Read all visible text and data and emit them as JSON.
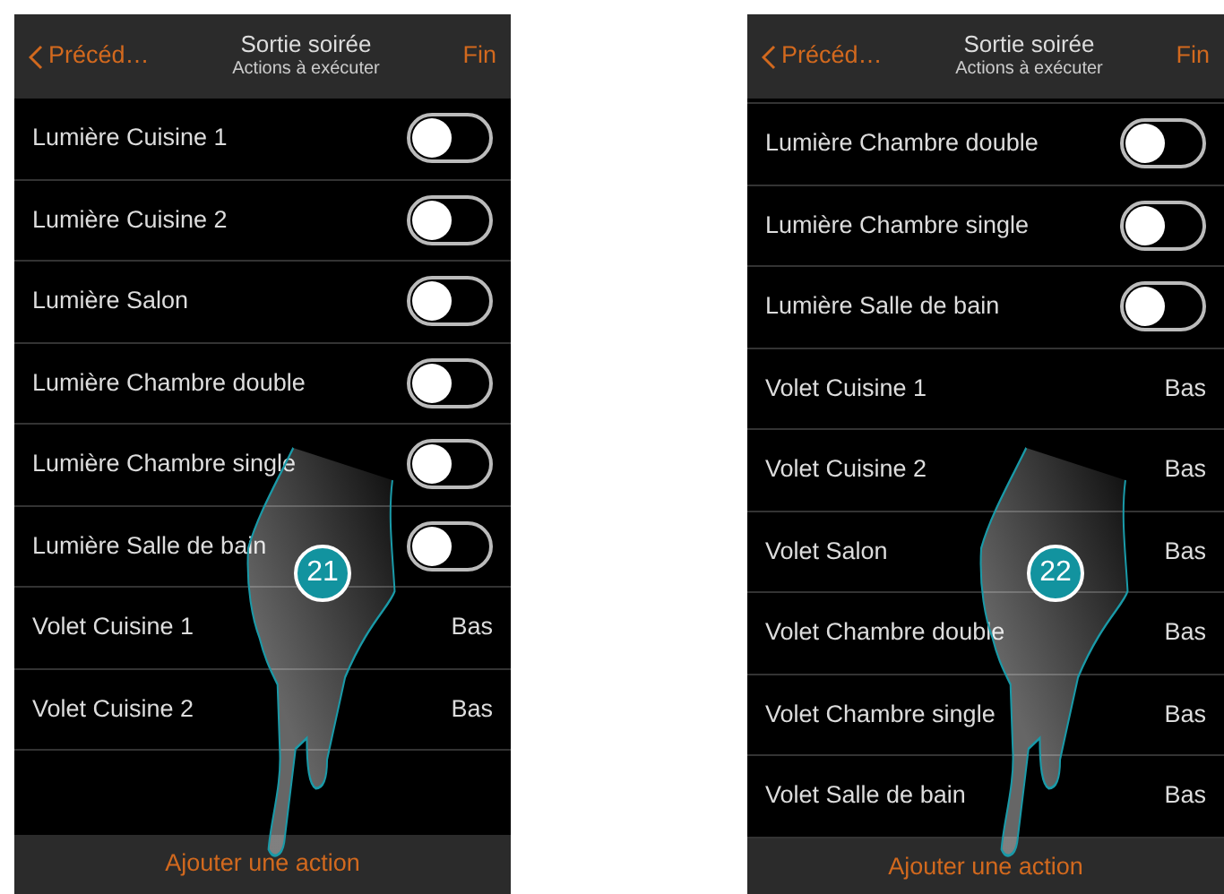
{
  "screens": [
    {
      "header": {
        "back": "Précéd…",
        "title": "Sortie soirée",
        "subtitle": "Actions à exécuter",
        "done": "Fin"
      },
      "partial_top": false,
      "rows": [
        {
          "kind": "toggle",
          "label": "Lumière Cuisine 1",
          "on": false
        },
        {
          "kind": "toggle",
          "label": "Lumière Cuisine 2",
          "on": false
        },
        {
          "kind": "toggle",
          "label": "Lumière Salon",
          "on": false
        },
        {
          "kind": "toggle",
          "label": "Lumière Chambre double",
          "on": false
        },
        {
          "kind": "toggle",
          "label": "Lumière Chambre single",
          "on": false
        },
        {
          "kind": "toggle",
          "label": "Lumière Salle de bain",
          "on": false
        },
        {
          "kind": "value",
          "label": "Volet Cuisine 1",
          "value": "Bas"
        },
        {
          "kind": "value",
          "label": "Volet Cuisine 2",
          "value": "Bas"
        }
      ],
      "footer": "Ajouter une action",
      "step": "21"
    },
    {
      "header": {
        "back": "Précéd…",
        "title": "Sortie soirée",
        "subtitle": "Actions à exécuter",
        "done": "Fin"
      },
      "partial_top": true,
      "rows": [
        {
          "kind": "toggle",
          "label": "Lumière Chambre double",
          "on": false
        },
        {
          "kind": "toggle",
          "label": "Lumière Chambre single",
          "on": false
        },
        {
          "kind": "toggle",
          "label": "Lumière Salle de bain",
          "on": false
        },
        {
          "kind": "value",
          "label": "Volet Cuisine 1",
          "value": "Bas"
        },
        {
          "kind": "value",
          "label": "Volet Cuisine 2",
          "value": "Bas"
        },
        {
          "kind": "value",
          "label": "Volet Salon",
          "value": "Bas"
        },
        {
          "kind": "value",
          "label": "Volet Chambre double",
          "value": "Bas"
        },
        {
          "kind": "value",
          "label": "Volet Chambre single",
          "value": "Bas"
        },
        {
          "kind": "value",
          "label": "Volet Salle de bain",
          "value": "Bas"
        }
      ],
      "footer": "Ajouter une action",
      "step": "22"
    }
  ]
}
